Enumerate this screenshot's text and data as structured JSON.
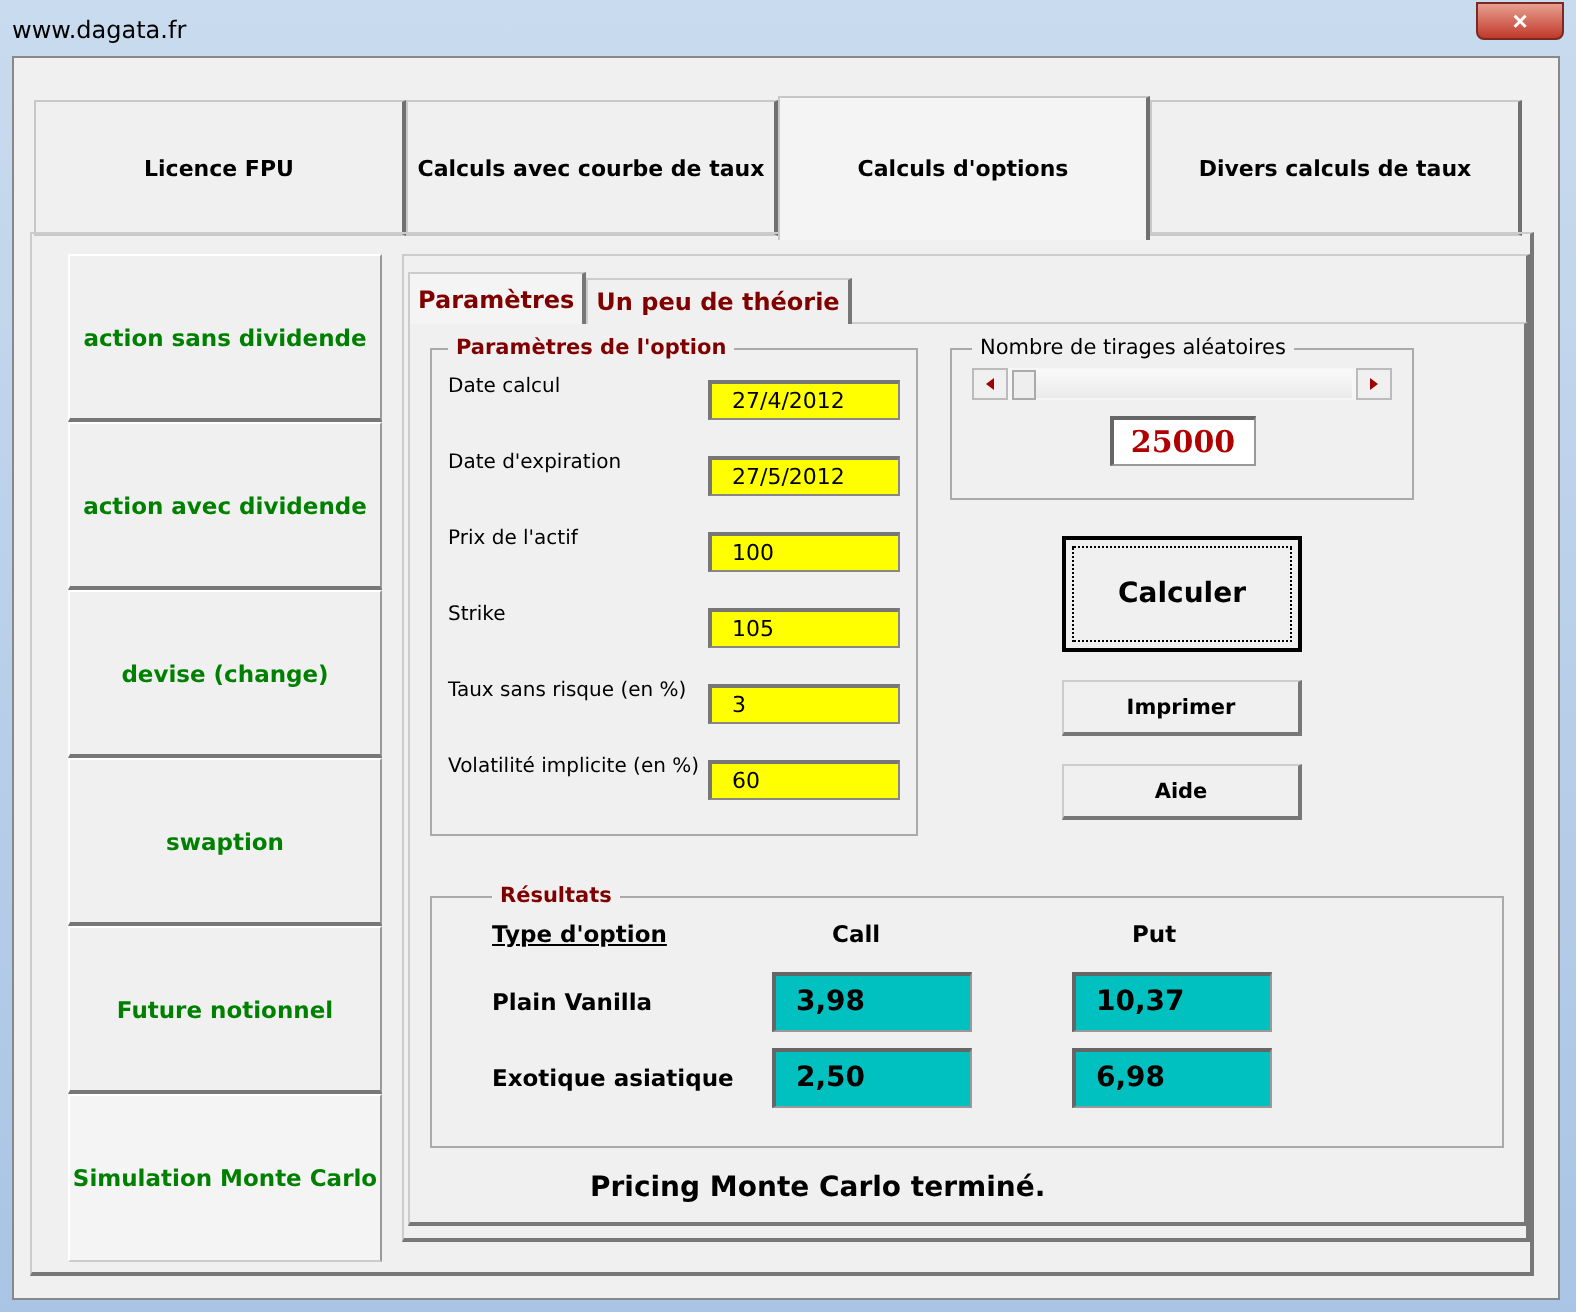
{
  "window": {
    "title": "www.dagata.fr",
    "close_label": "×"
  },
  "tabs": [
    {
      "label": "Licence FPU",
      "selected": false
    },
    {
      "label": "Calculs avec courbe de taux",
      "selected": false
    },
    {
      "label": "Calculs d'options",
      "selected": true
    },
    {
      "label": "Divers calculs de taux",
      "selected": false
    }
  ],
  "sidebar": {
    "items": [
      {
        "label": "action sans dividende",
        "selected": false
      },
      {
        "label": "action avec dividende",
        "selected": false
      },
      {
        "label": "devise (change)",
        "selected": false
      },
      {
        "label": "swaption",
        "selected": false
      },
      {
        "label": "Future notionnel",
        "selected": false
      },
      {
        "label": "Simulation Monte Carlo",
        "selected": true
      }
    ]
  },
  "subtabs": [
    {
      "label": "Paramètres",
      "selected": true
    },
    {
      "label": "Un peu de théorie",
      "selected": false
    }
  ],
  "parameters": {
    "title": "Paramètres de l'option",
    "fields": [
      {
        "label": "Date calcul",
        "value": "27/4/2012"
      },
      {
        "label": "Date d'expiration",
        "value": "27/5/2012"
      },
      {
        "label": "Prix de l'actif",
        "value": "100"
      },
      {
        "label": "Strike",
        "value": "105"
      },
      {
        "label": "Taux sans risque (en %)",
        "value": "3"
      },
      {
        "label": "Volatilité implicite (en %)",
        "value": "60"
      }
    ]
  },
  "draws": {
    "title": "Nombre de tirages aléatoires",
    "level": 0,
    "value": "25000"
  },
  "buttons": [
    {
      "label": "Calculer",
      "kind": "default"
    },
    {
      "label": "Imprimer",
      "kind": "normal"
    },
    {
      "label": "Aide",
      "kind": "normal"
    }
  ],
  "results": {
    "title": "Résultats",
    "header": "Type d'option",
    "columns": [
      "Call",
      "Put"
    ],
    "rows": [
      {
        "label": "Plain Vanilla",
        "values": [
          "3,98",
          "10,37"
        ]
      },
      {
        "label": "Exotique asiatique",
        "values": [
          "2,50",
          "6,98"
        ]
      }
    ]
  },
  "status": "Pricing Monte Carlo terminé."
}
